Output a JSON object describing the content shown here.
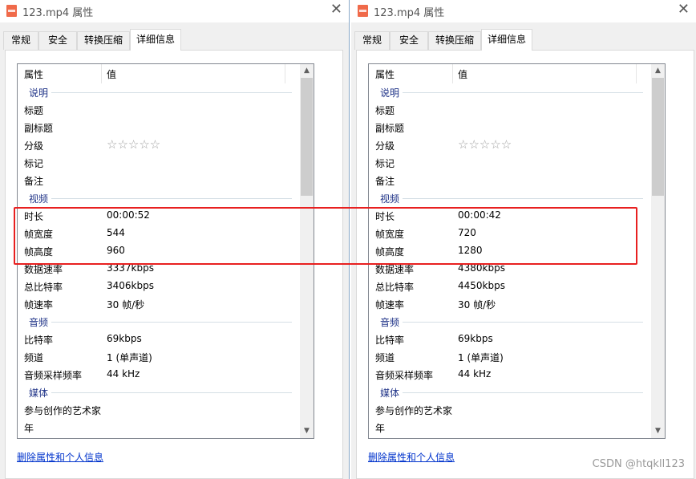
{
  "left": {
    "title": "123.mp4 属性",
    "tabs": [
      "常规",
      "安全",
      "转换压缩",
      "详细信息"
    ],
    "active_tab": "详细信息",
    "columns": [
      "属性",
      "值"
    ],
    "groups": {
      "description": "说明",
      "video": "视频",
      "audio": "音频",
      "media": "媒体"
    },
    "description_rows": [
      {
        "key": "标题",
        "value": ""
      },
      {
        "key": "副标题",
        "value": ""
      },
      {
        "key": "分级",
        "value": "☆☆☆☆☆"
      },
      {
        "key": "标记",
        "value": ""
      },
      {
        "key": "备注",
        "value": ""
      }
    ],
    "video_rows": [
      {
        "key": "时长",
        "value": "00:00:52"
      },
      {
        "key": "帧宽度",
        "value": "544"
      },
      {
        "key": "帧高度",
        "value": "960"
      },
      {
        "key": "数据速率",
        "value": "3337kbps"
      },
      {
        "key": "总比特率",
        "value": "3406kbps"
      },
      {
        "key": "帧速率",
        "value": "30 帧/秒"
      }
    ],
    "audio_rows": [
      {
        "key": "比特率",
        "value": "69kbps"
      },
      {
        "key": "频道",
        "value": "1 (单声道)"
      },
      {
        "key": "音频采样频率",
        "value": "44 kHz"
      }
    ],
    "media_rows": [
      {
        "key": "参与创作的艺术家",
        "value": ""
      },
      {
        "key": "年",
        "value": ""
      }
    ],
    "link": "删除属性和个人信息"
  },
  "right": {
    "title": "123.mp4 属性",
    "tabs": [
      "常规",
      "安全",
      "转换压缩",
      "详细信息"
    ],
    "active_tab": "详细信息",
    "columns": [
      "属性",
      "值"
    ],
    "groups": {
      "description": "说明",
      "video": "视频",
      "audio": "音频",
      "media": "媒体"
    },
    "description_rows": [
      {
        "key": "标题",
        "value": ""
      },
      {
        "key": "副标题",
        "value": ""
      },
      {
        "key": "分级",
        "value": "☆☆☆☆☆"
      },
      {
        "key": "标记",
        "value": ""
      },
      {
        "key": "备注",
        "value": ""
      }
    ],
    "video_rows": [
      {
        "key": "时长",
        "value": "00:00:42"
      },
      {
        "key": "帧宽度",
        "value": "720"
      },
      {
        "key": "帧高度",
        "value": "1280"
      },
      {
        "key": "数据速率",
        "value": "4380kbps"
      },
      {
        "key": "总比特率",
        "value": "4450kbps"
      },
      {
        "key": "帧速率",
        "value": "30 帧/秒"
      }
    ],
    "audio_rows": [
      {
        "key": "比特率",
        "value": "69kbps"
      },
      {
        "key": "频道",
        "value": "1 (单声道)"
      },
      {
        "key": "音频采样频率",
        "value": "44 kHz"
      }
    ],
    "media_rows": [
      {
        "key": "参与创作的艺术家",
        "value": ""
      },
      {
        "key": "年",
        "value": ""
      }
    ],
    "link": "删除属性和个人信息"
  },
  "watermark": "CSDN @htqkll123",
  "colors": {
    "highlight": "#e82020",
    "group_text": "#1e3287",
    "link": "#0033cc"
  }
}
